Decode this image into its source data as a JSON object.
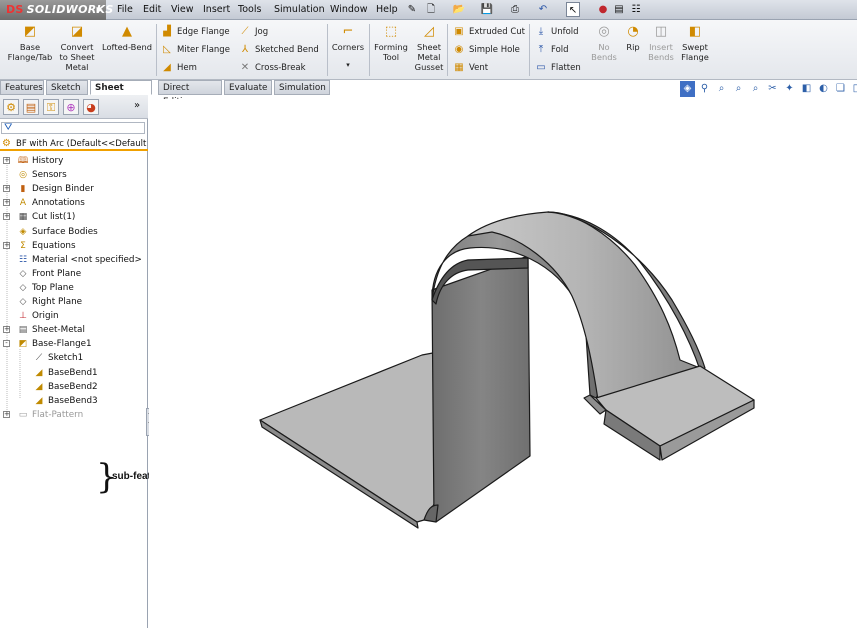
{
  "app": {
    "name": "SOLIDWORKS",
    "logo_prefix": "DS"
  },
  "menu": [
    "File",
    "Edit",
    "View",
    "Insert",
    "Tools",
    "Simulation",
    "Window",
    "Help"
  ],
  "ribbon": {
    "base_flange": "Base Flange/Tab",
    "convert": "Convert to Sheet Metal",
    "lofted_bend": "Lofted-Bend",
    "edge_flange": "Edge Flange",
    "miter_flange": "Miter Flange",
    "hem": "Hem",
    "jog": "Jog",
    "sketched_bend": "Sketched Bend",
    "cross_break": "Cross-Break",
    "corners": "Corners",
    "forming_tool": "Forming Tool",
    "gusset": "Sheet Metal Gusset",
    "extruded_cut": "Extruded Cut",
    "simple_hole": "Simple Hole",
    "vent": "Vent",
    "unfold": "Unfold",
    "fold": "Fold",
    "flatten": "Flatten",
    "no_bends": "No Bends",
    "rip": "Rip",
    "insert_bends": "Insert Bends",
    "swept_flange": "Swept Flange"
  },
  "tabs": [
    "Features",
    "Sketch",
    "Sheet Metal",
    "Direct Editing",
    "Evaluate",
    "Simulation"
  ],
  "active_tab": "Sheet Metal",
  "tree": {
    "root": "BF with Arc  (Default<<Default",
    "items": [
      {
        "label": "History",
        "expand": "+",
        "indent": 0
      },
      {
        "label": "Sensors",
        "expand": "",
        "indent": 0
      },
      {
        "label": "Design Binder",
        "expand": "+",
        "indent": 0
      },
      {
        "label": "Annotations",
        "expand": "+",
        "indent": 0
      },
      {
        "label": "Cut list(1)",
        "expand": "+",
        "indent": 0
      },
      {
        "label": "Surface Bodies",
        "expand": "",
        "indent": 0
      },
      {
        "label": "Equations",
        "expand": "+",
        "indent": 0
      },
      {
        "label": "Material <not specified>",
        "expand": "",
        "indent": 0
      },
      {
        "label": "Front Plane",
        "expand": "",
        "indent": 0
      },
      {
        "label": "Top Plane",
        "expand": "",
        "indent": 0
      },
      {
        "label": "Right Plane",
        "expand": "",
        "indent": 0
      },
      {
        "label": "Origin",
        "expand": "",
        "indent": 0
      },
      {
        "label": "Sheet-Metal",
        "expand": "+",
        "indent": 0
      },
      {
        "label": "Base-Flange1",
        "expand": "-",
        "indent": 0
      },
      {
        "label": "Sketch1",
        "expand": "",
        "indent": 1
      },
      {
        "label": "BaseBend1",
        "expand": "",
        "indent": 1
      },
      {
        "label": "BaseBend2",
        "expand": "",
        "indent": 1
      },
      {
        "label": "BaseBend3",
        "expand": "",
        "indent": 1
      },
      {
        "label": "Flat-Pattern",
        "expand": "+",
        "indent": 0
      }
    ]
  },
  "annotation": {
    "text": "sub-features"
  },
  "colors": {
    "part_grey": "#8a8a8a",
    "accent_orange": "#f0a000",
    "ribbon_bg": "#e9ecf0"
  }
}
